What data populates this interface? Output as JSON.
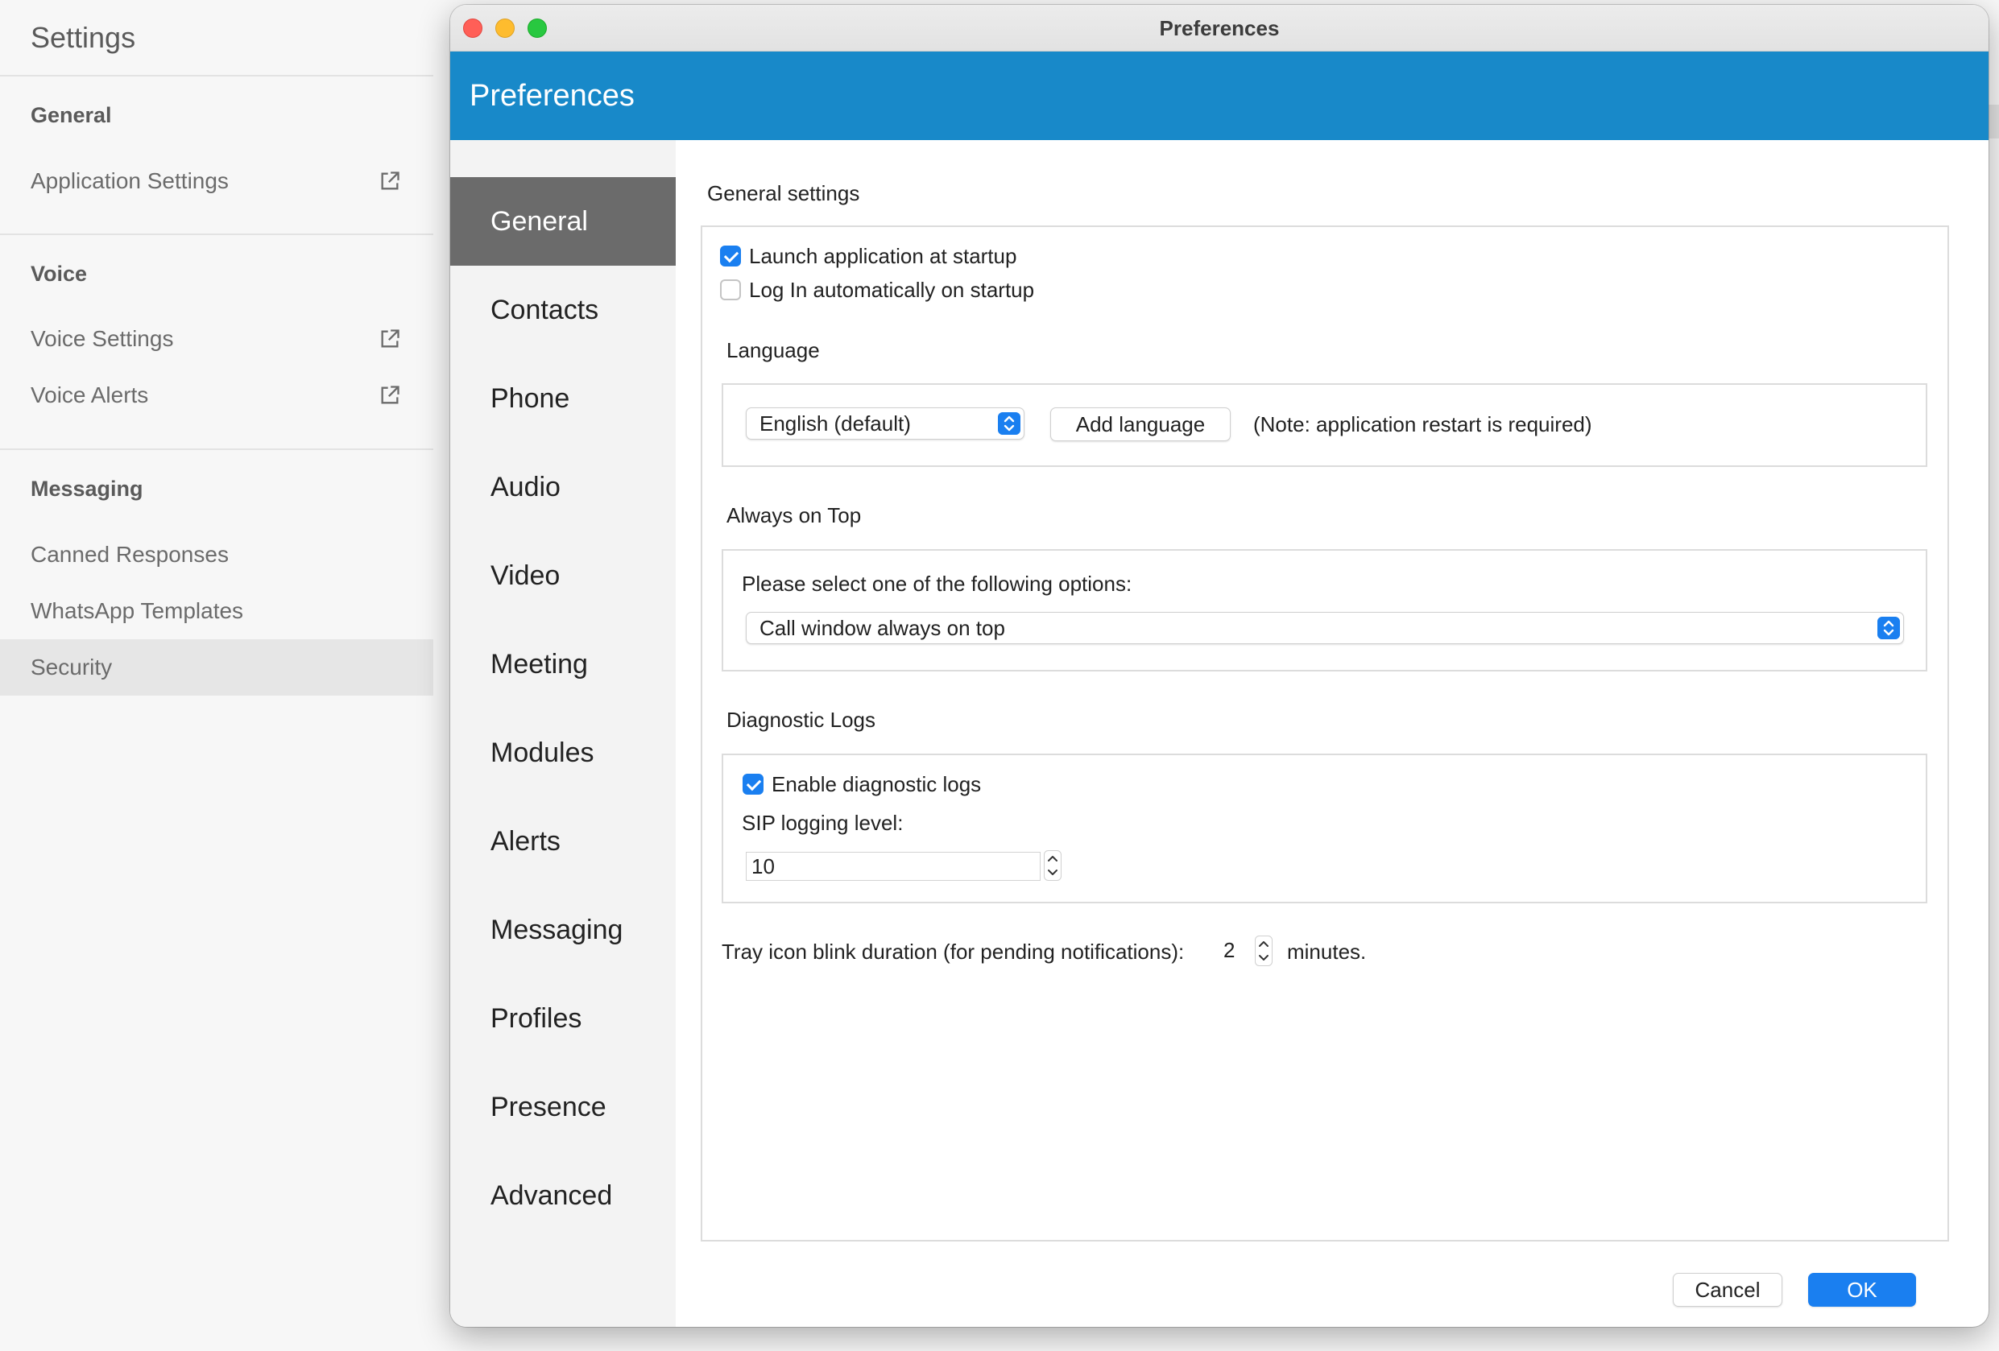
{
  "background_settings": {
    "title": "Settings",
    "sections": [
      {
        "heading": "General",
        "items": [
          {
            "label": "Application Settings",
            "external": true
          }
        ]
      },
      {
        "heading": "Voice",
        "items": [
          {
            "label": "Voice Settings",
            "external": true
          },
          {
            "label": "Voice Alerts",
            "external": true
          }
        ]
      },
      {
        "heading": "Messaging",
        "items": [
          {
            "label": "Canned Responses"
          },
          {
            "label": "WhatsApp Templates"
          },
          {
            "label": "Security",
            "selected": true
          }
        ]
      }
    ]
  },
  "window": {
    "title": "Preferences",
    "header_title": "Preferences",
    "accent_color": "#1889c9"
  },
  "categories": [
    "General",
    "Contacts",
    "Phone",
    "Audio",
    "Video",
    "Meeting",
    "Modules",
    "Alerts",
    "Messaging",
    "Profiles",
    "Presence",
    "Advanced"
  ],
  "active_category": "General",
  "general": {
    "section_title": "General settings",
    "launch_at_startup": {
      "label": "Launch application at startup",
      "checked": true
    },
    "auto_login": {
      "label": "Log In automatically on startup",
      "checked": false
    },
    "language": {
      "title": "Language",
      "selected": "English (default)",
      "add_button": "Add language",
      "note": "(Note: application restart is required)"
    },
    "always_on_top": {
      "title": "Always on Top",
      "prompt": "Please select one of the following options:",
      "selected": "Call window always on top"
    },
    "diagnostic_logs": {
      "title": "Diagnostic Logs",
      "enable": {
        "label": "Enable diagnostic logs",
        "checked": true
      },
      "sip_label": "SIP logging level:",
      "sip_value": "10"
    },
    "tray_blink": {
      "label": "Tray icon blink duration (for pending notifications):",
      "value": "2",
      "unit": "minutes."
    }
  },
  "footer": {
    "cancel": "Cancel",
    "ok": "OK"
  }
}
